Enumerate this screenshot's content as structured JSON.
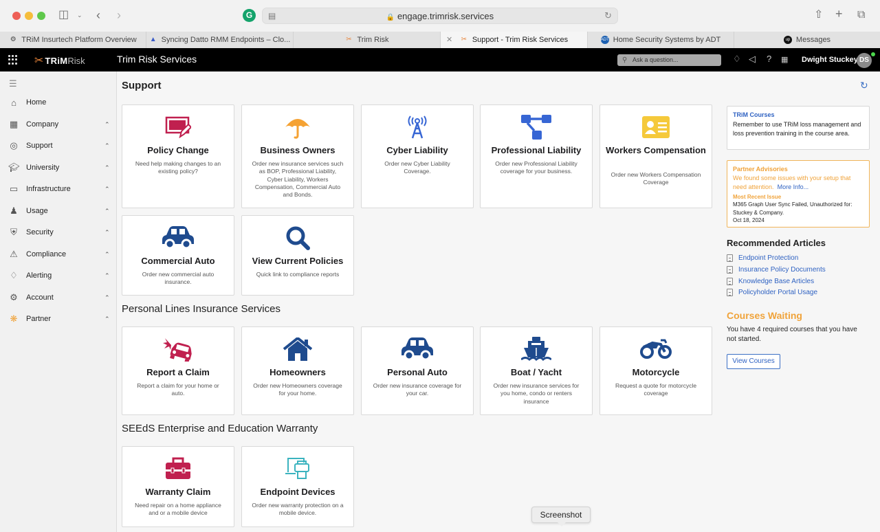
{
  "browser": {
    "url": "engage.trimrisk.services",
    "tabs": [
      {
        "label": "TRiM Insurtech Platform Overview",
        "icon": "globe-icon",
        "active": false
      },
      {
        "label": "Syncing Datto RMM Endpoints – Clo...",
        "icon": "datto-icon",
        "active": false
      },
      {
        "label": "Trim Risk",
        "icon": "trimrisk-icon",
        "active": false
      },
      {
        "label": "Support - Trim Risk Services",
        "icon": "trimrisk-icon",
        "active": true
      },
      {
        "label": "Home Security Systems by ADT",
        "icon": "adt-icon",
        "active": false
      },
      {
        "label": "Messages",
        "icon": "upwork-icon",
        "active": false
      }
    ]
  },
  "header": {
    "logo_trim": "TRiM",
    "logo_risk": "Risk",
    "app_title": "Trim Risk Services",
    "search_placeholder": "Ask a question...",
    "user_name": "Dwight Stuckey",
    "avatar_initials": "DS"
  },
  "sidebar": {
    "items": [
      {
        "label": "Home",
        "icon": "home-icon",
        "expandable": false
      },
      {
        "label": "Company",
        "icon": "building-icon",
        "expandable": true
      },
      {
        "label": "Support",
        "icon": "lifebuoy-icon",
        "expandable": true
      },
      {
        "label": "University",
        "icon": "graduation-cap-icon",
        "expandable": true
      },
      {
        "label": "Infrastructure",
        "icon": "monitor-icon",
        "expandable": true
      },
      {
        "label": "Usage",
        "icon": "users-icon",
        "expandable": true
      },
      {
        "label": "Security",
        "icon": "shield-icon",
        "expandable": true
      },
      {
        "label": "Compliance",
        "icon": "warning-icon",
        "expandable": true
      },
      {
        "label": "Alerting",
        "icon": "bell-icon",
        "expandable": true
      },
      {
        "label": "Account",
        "icon": "gear-icon",
        "expandable": true
      },
      {
        "label": "Partner",
        "icon": "partner-icon",
        "expandable": true
      }
    ]
  },
  "main": {
    "page_title": "Support",
    "sections": [
      {
        "title": "",
        "cards": [
          {
            "title": "Policy Change",
            "desc": "Need help making changes to an existing policy?",
            "icon": "edit-document-icon"
          },
          {
            "title": "Business Owners",
            "desc": "Order new insurance services such as BOP, Professional Liability, Cyber Liability, Workers Compensation, Commercial Auto and Bonds.",
            "icon": "umbrella-icon"
          },
          {
            "title": "Cyber Liability",
            "desc": "Order new Cyber Liability Coverage.",
            "icon": "broadcast-tower-icon"
          },
          {
            "title": "Professional Liability",
            "desc": "Order new Professional Liability coverage for your business.",
            "icon": "hierarchy-icon"
          },
          {
            "title": "Workers Compensation",
            "desc": "Order new Workers Compensation Coverage",
            "icon": "id-card-icon"
          },
          {
            "title": "Commercial Auto",
            "desc": "Order new commercial auto insurance.",
            "icon": "car-icon"
          },
          {
            "title": "View Current Policies",
            "desc": "Quick link to compliance reports",
            "icon": "search-icon"
          }
        ]
      },
      {
        "title": "Personal Lines Insurance Services",
        "cards": [
          {
            "title": "Report a Claim",
            "desc": "Report a claim for your home or auto.",
            "icon": "car-crash-icon"
          },
          {
            "title": "Homeowners",
            "desc": "Order new Homeowners coverage for your home.",
            "icon": "house-icon"
          },
          {
            "title": "Personal Auto",
            "desc": "Order new insurance coverage for your car.",
            "icon": "car-icon"
          },
          {
            "title": "Boat / Yacht",
            "desc": "Order new insurance services for you home, condo or renters insurance",
            "icon": "ship-icon"
          },
          {
            "title": "Motorcycle",
            "desc": "Request a quote for motorcycle coverage",
            "icon": "motorcycle-icon"
          }
        ]
      },
      {
        "title": "SEEdS Enterprise and Education Warranty",
        "cards": [
          {
            "title": "Warranty Claim",
            "desc": "Need repair on a home appliance and or a mobile device",
            "icon": "toolbox-icon"
          },
          {
            "title": "Endpoint Devices",
            "desc": "Order new warranty protection on a mobile device.",
            "icon": "devices-icon"
          }
        ]
      }
    ]
  },
  "right": {
    "courses_box": {
      "title": "TRiM Courses",
      "text": "Remember to use TRiM loss management and loss prevention training in the course area."
    },
    "advisory_box": {
      "title": "Partner Advisories",
      "text": "We found some issues with your setup that need attention.",
      "more_link": "More Info...",
      "recent_label": "Most Recent Issue",
      "recent_text": "M365 Graph User Sync Failed, Unauthorized for: Stuckey & Company.",
      "recent_date": "Oct 18, 2024"
    },
    "recommended_title": "Recommended Articles",
    "articles": [
      "Endpoint Protection",
      "Insurance Policy Documents",
      "Knowledge Base Articles",
      "Policyholder Portal Usage"
    ],
    "courses_waiting_title": "Courses Waiting",
    "courses_waiting_text": "You have 4 required courses that you have not started.",
    "view_courses_label": "View Courses"
  },
  "tooltip": "Screenshot",
  "colors": {
    "crimson": "#c0204f",
    "orange": "#f5a233",
    "blue": "#3766d4",
    "navy": "#1f4b8e",
    "yellow": "#f5c93b",
    "teal": "#3bb3bf",
    "link": "#2f62c2"
  }
}
